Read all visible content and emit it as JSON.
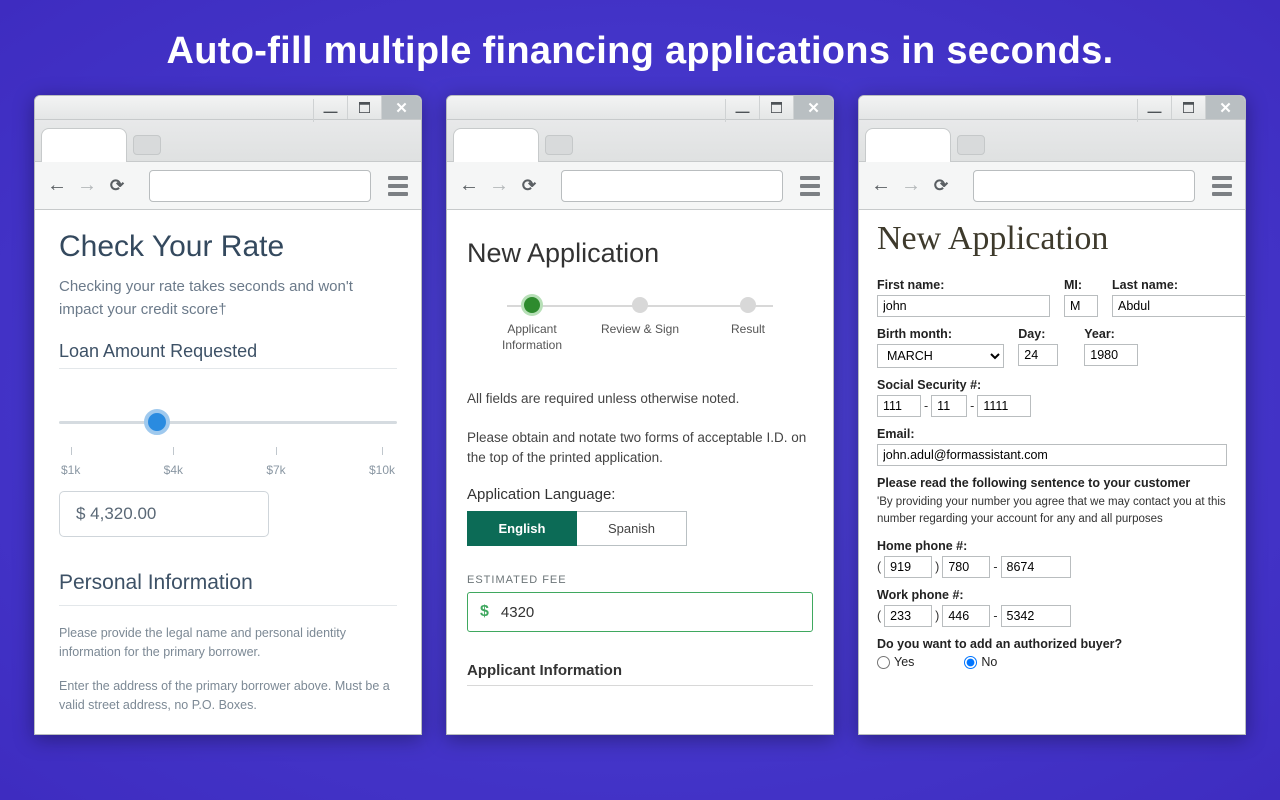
{
  "hero": "Auto-fill multiple financing applications in seconds.",
  "browser": {
    "min_glyph": "—",
    "close_glyph": "✕",
    "back_glyph": "←",
    "forward_glyph": "→",
    "reload_glyph": "⟳"
  },
  "w1": {
    "title": "Check Your Rate",
    "subtitle": "Checking your rate takes seconds and won't impact your credit score†",
    "slider_label": "Loan Amount Requested",
    "ticks": [
      "$1k",
      "$4k",
      "$7k",
      "$10k"
    ],
    "amount": "$ 4,320.00",
    "section2": "Personal Information",
    "para1": "Please provide the legal name and personal identity information for the primary borrower.",
    "para2": "Enter the address of the primary borrower above. Must be a valid street address, no P.O. Boxes."
  },
  "w2": {
    "title": "New Application",
    "steps": [
      {
        "label": "Applicant Information"
      },
      {
        "label": "Review & Sign"
      },
      {
        "label": "Result"
      }
    ],
    "required_note": "All fields are required unless otherwise noted.",
    "id_note": "Please obtain and notate two forms of acceptable I.D. on the top of the printed application.",
    "lang_label": "Application Language:",
    "lang_english": "English",
    "lang_spanish": "Spanish",
    "fee_label": "ESTIMATED FEE",
    "fee_currency": "$",
    "fee_value": "4320",
    "section": "Applicant Information"
  },
  "w3": {
    "title": "New Application",
    "labels": {
      "first": "First name:",
      "mi": "MI:",
      "last": "Last name:",
      "birth": "Birth month:",
      "day": "Day:",
      "year": "Year:",
      "ssn": "Social Security #:",
      "email": "Email:",
      "disclaimer_h": "Please read the following sentence to your customer",
      "home": "Home phone #:",
      "work": "Work phone #:",
      "auth": "Do you want to add an authorized buyer?"
    },
    "values": {
      "first": "john",
      "mi": "M",
      "last": "Abdul",
      "birth": "MARCH",
      "day": "24",
      "year": "1980",
      "ssn1": "111",
      "ssn2": "11",
      "ssn3": "1111",
      "email": "john.adul@formassistant.com",
      "home1": "919",
      "home2": "780",
      "home3": "8674",
      "work1": "233",
      "work2": "446",
      "work3": "5342"
    },
    "disclaimer": "'By providing your number you agree that we may contact you at this number regarding your account for any and all purposes",
    "radio_yes": "Yes",
    "radio_no": "No"
  }
}
